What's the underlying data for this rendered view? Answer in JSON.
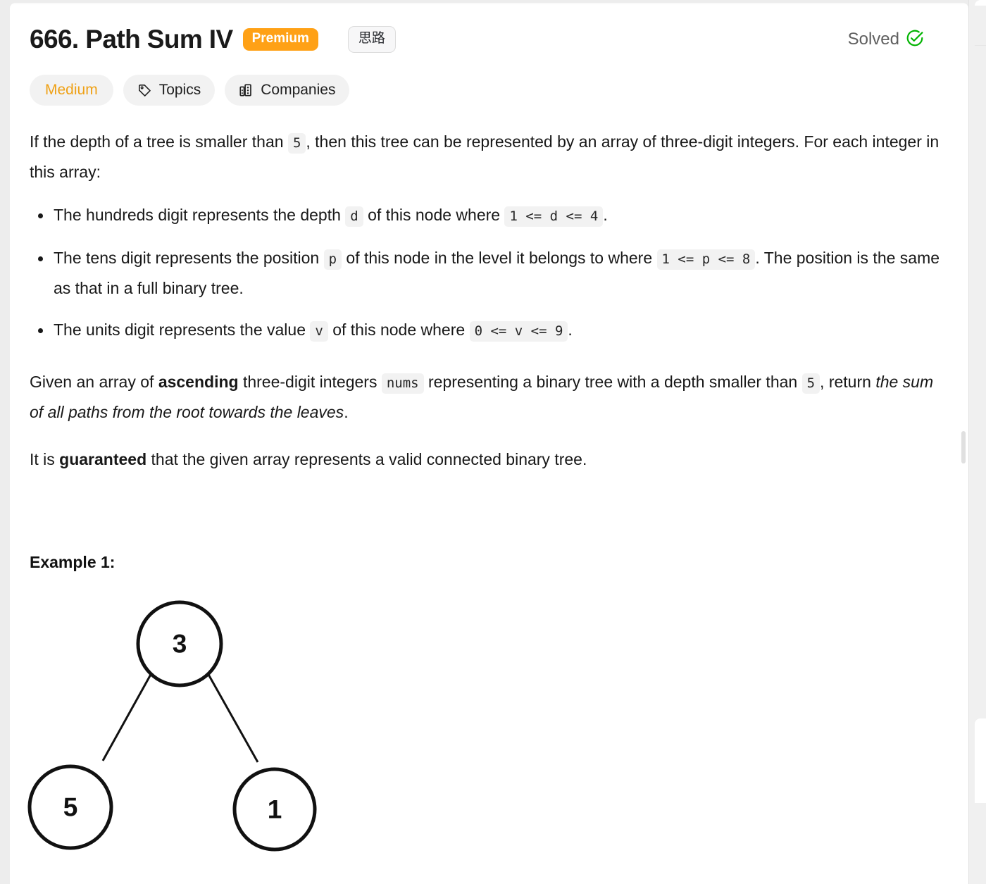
{
  "header": {
    "title": "666. Path Sum IV",
    "premium_label": "Premium",
    "notes_button_label": "思路",
    "status_label": "Solved",
    "status_icon": "circle-check-icon",
    "status_color": "#00b300",
    "premium_color": "#ffa116"
  },
  "tags": {
    "difficulty": "Medium",
    "difficulty_color": "#efa116",
    "topics_label": "Topics",
    "topics_icon": "tag-icon",
    "companies_label": "Companies",
    "companies_icon": "building-icon"
  },
  "description": {
    "intro_part1": "If the depth of a tree is smaller than",
    "intro_code1": "5",
    "intro_part2": ", then this tree can be represented by an array of three-digit integers. For each integer in this array:",
    "bullets": [
      {
        "text1": "The hundreds digit represents the depth",
        "code1": "d",
        "text2": "of this node where",
        "code2": "1 <= d <= 4",
        "text3": "."
      },
      {
        "text1": "The tens digit represents the position",
        "code1": "p",
        "text2": "of this node in the level it belongs to where",
        "code2": "1 <= p <= 8",
        "text3": ". The position is the same as that in a full binary tree."
      },
      {
        "text1": "The units digit represents the value",
        "code1": "v",
        "text2": "of this node where",
        "code2": "0 <= v <= 9",
        "text3": "."
      }
    ],
    "given_part1": "Given an array of",
    "given_bold": "ascending",
    "given_part2": "three-digit integers",
    "given_code1": "nums",
    "given_part3": "representing a binary tree with a depth smaller than",
    "given_code2": "5",
    "given_part4": ", return",
    "given_italic": "the sum of all paths from the root towards the leaves",
    "given_part5": ".",
    "guaranteed_part1": "It is",
    "guaranteed_bold": "guaranteed",
    "guaranteed_part2": "that the given array represents a valid connected binary tree."
  },
  "example": {
    "heading": "Example 1:",
    "tree": {
      "root_value": "3",
      "left_value": "5",
      "right_value": "1"
    }
  }
}
